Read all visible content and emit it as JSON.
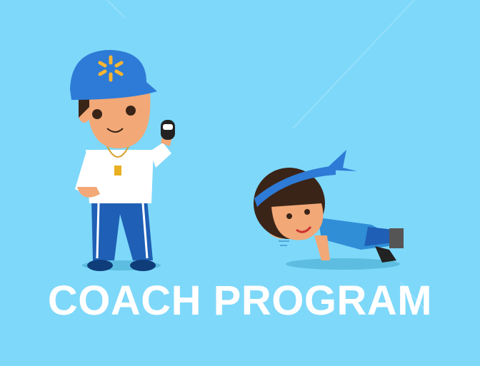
{
  "title": "COACH PROGRAM",
  "colors": {
    "background": "#7ed8fa",
    "cap": "#2d7bd6",
    "logo": "#f9b533",
    "pants": "#1f5fb5",
    "skin": "#f2a877"
  }
}
